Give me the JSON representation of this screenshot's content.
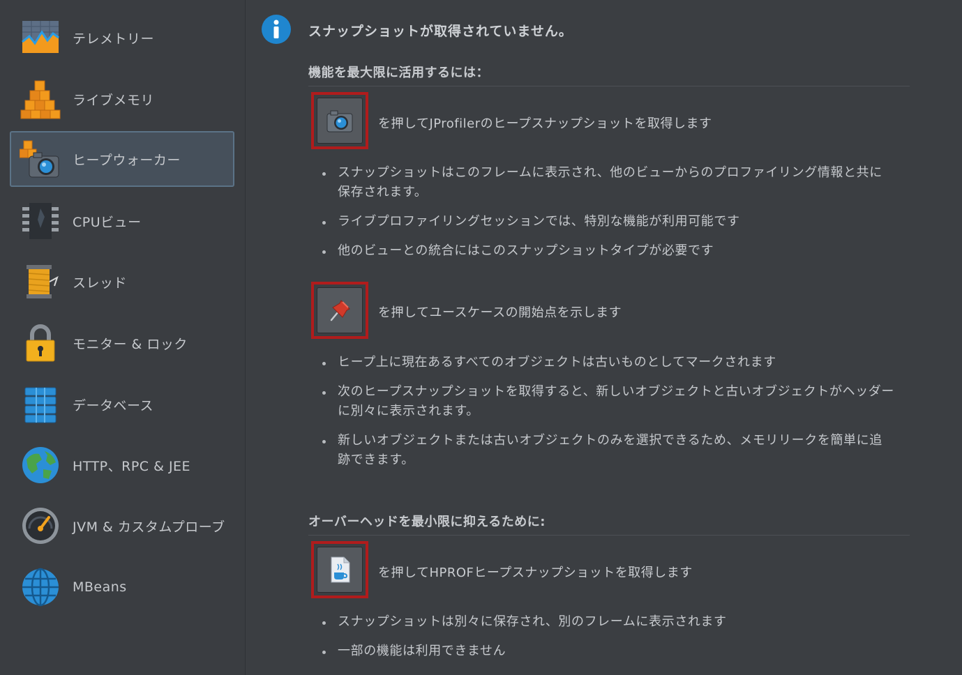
{
  "sidebar": {
    "items": [
      {
        "label": "テレメトリー",
        "icon": "telemetry-icon"
      },
      {
        "label": "ライブメモリ",
        "icon": "live-memory-icon"
      },
      {
        "label": "ヒープウォーカー",
        "icon": "heap-walker-icon",
        "selected": true
      },
      {
        "label": "CPUビュー",
        "icon": "cpu-chip-icon"
      },
      {
        "label": "スレッド",
        "icon": "thread-spool-icon"
      },
      {
        "label": "モニター & ロック",
        "icon": "padlock-icon"
      },
      {
        "label": "データベース",
        "icon": "database-icon"
      },
      {
        "label": "HTTP、RPC & JEE",
        "icon": "globe-icon"
      },
      {
        "label": "JVM & カスタムプローブ",
        "icon": "gauge-icon"
      },
      {
        "label": "MBeans",
        "icon": "mbeans-globe-icon"
      }
    ]
  },
  "main": {
    "title": "スナップショットが取得されていません。",
    "section1": {
      "heading": "機能を最大限に活用するには：",
      "action1": {
        "text": "を押してJProfilerのヒープスナップショットを取得します",
        "bullets": [
          "スナップショットはこのフレームに表示され、他のビューからのプロファイリング情報と共に保存されます。",
          "ライブプロファイリングセッションでは、特別な機能が利用可能です",
          "他のビューとの統合にはこのスナップショットタイプが必要です"
        ]
      },
      "action2": {
        "text": "を押してユースケースの開始点を示します",
        "bullets": [
          "ヒープ上に現在あるすべてのオブジェクトは古いものとしてマークされます",
          "次のヒープスナップショットを取得すると、新しいオブジェクトと古いオブジェクトがヘッダーに別々に表示されます。",
          "新しいオブジェクトまたは古いオブジェクトのみを選択できるため、メモリリークを簡単に追跡できます。"
        ]
      }
    },
    "section2": {
      "heading": "オーバーヘッドを最小限に抑えるために:",
      "action3": {
        "text": "を押してHPROFヒープスナップショットを取得します",
        "bullets": [
          "スナップショットは別々に保存され、別のフレームに表示されます",
          "一部の機能は利用できません"
        ]
      }
    },
    "colors": {
      "highlight_border": "#b01c1c",
      "selected_item_bg": "#46505b",
      "info_blue": "#1f86cf"
    }
  }
}
